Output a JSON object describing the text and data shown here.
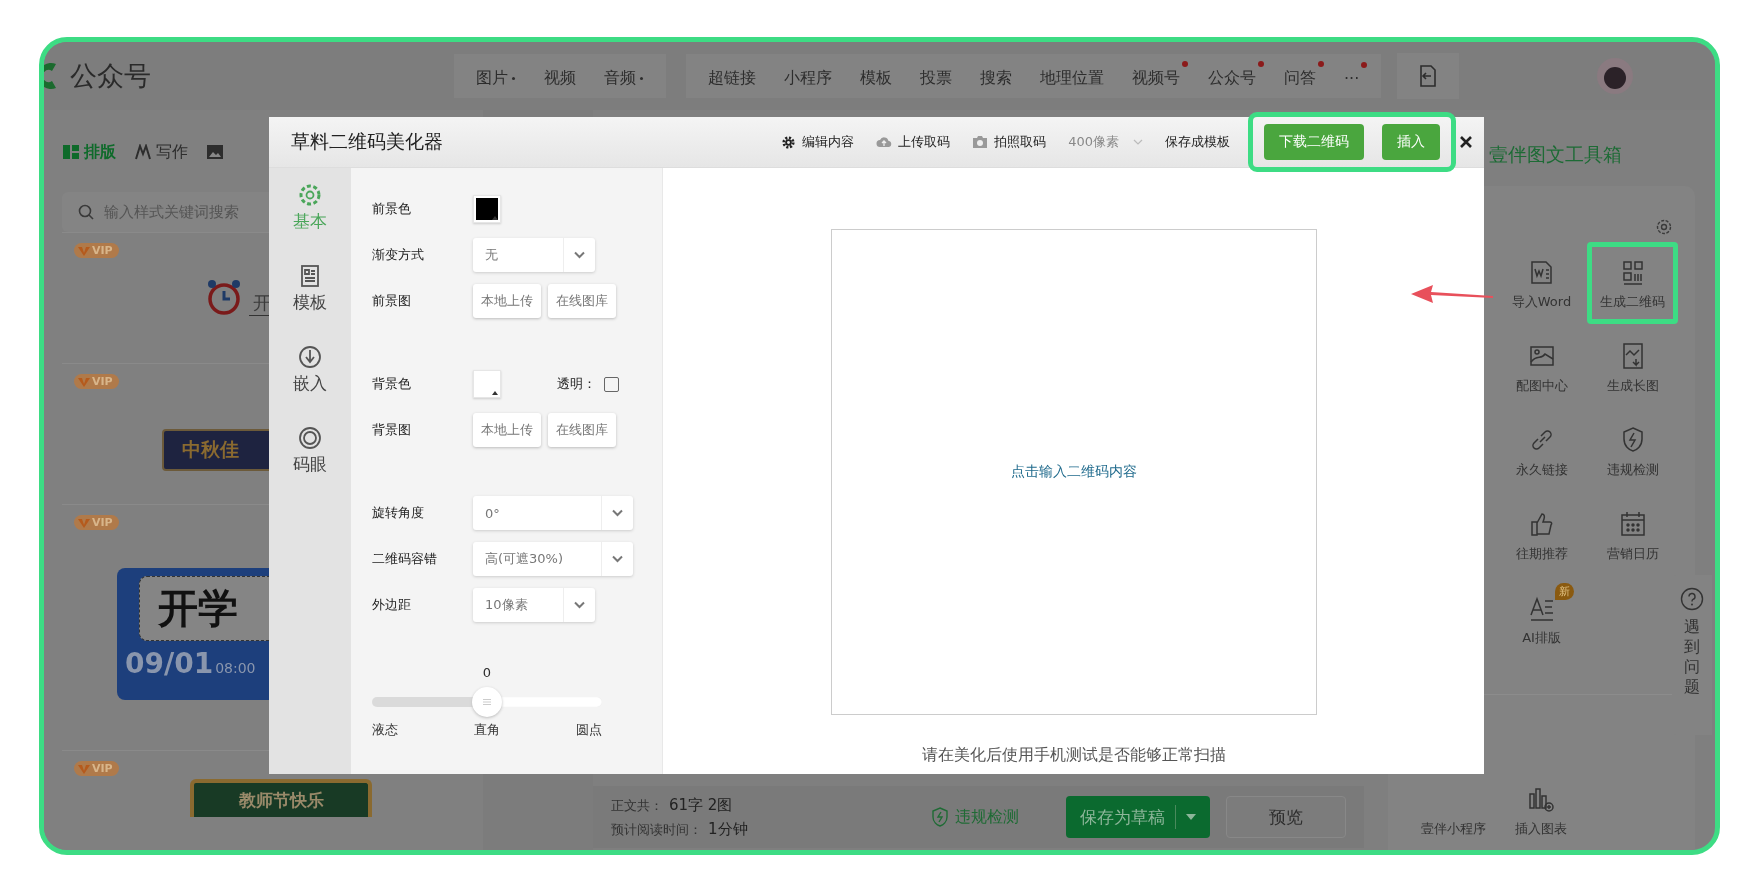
{
  "topbar": {
    "logo": "公众号",
    "nav_groups": [
      [
        {
          "label": "图片",
          "caret": true,
          "dot": false
        },
        {
          "label": "视频",
          "caret": false,
          "dot": false
        },
        {
          "label": "音频",
          "caret": true,
          "dot": false
        }
      ],
      [
        {
          "label": "超链接",
          "caret": false,
          "dot": false
        },
        {
          "label": "小程序",
          "caret": false,
          "dot": false
        },
        {
          "label": "模板",
          "caret": false,
          "dot": false
        },
        {
          "label": "投票",
          "caret": false,
          "dot": false
        },
        {
          "label": "搜索",
          "caret": false,
          "dot": false
        },
        {
          "label": "地理位置",
          "caret": false,
          "dot": false
        },
        {
          "label": "视频号",
          "caret": false,
          "dot": true
        },
        {
          "label": "公众号",
          "caret": false,
          "dot": true
        },
        {
          "label": "问答",
          "caret": false,
          "dot": true
        },
        {
          "label": "···",
          "caret": false,
          "dot": true
        }
      ]
    ]
  },
  "left_panel": {
    "tabs": [
      {
        "label": "排版",
        "selected": true
      },
      {
        "label": "写作",
        "selected": false
      }
    ],
    "search": {
      "placeholder": "输入样式关键词搜索"
    },
    "templates": [
      {
        "kind": "clock",
        "badge": "VIP",
        "text": "开"
      },
      {
        "kind": "banner",
        "badge": "VIP",
        "text": "中秋佳"
      },
      {
        "kind": "ticket",
        "badge": "VIP",
        "text": "开学",
        "date": "09/01",
        "time": "08:00"
      },
      {
        "kind": "plaque",
        "badge": "VIP",
        "text": "教师节快乐"
      }
    ]
  },
  "modal": {
    "title": "草料二维码美化器",
    "actions": [
      {
        "kind": "gear",
        "label": "编辑内容"
      },
      {
        "kind": "cloud",
        "label": "上传取码"
      },
      {
        "kind": "camera",
        "label": "拍照取码"
      },
      {
        "kind": "dropdown",
        "label": "400像素"
      },
      {
        "kind": "text",
        "label": "保存成模板"
      }
    ],
    "buttons": [
      "下载二维码",
      "插入"
    ],
    "buttons_highlighted": true,
    "nav": [
      {
        "kind": "gear",
        "label": "基本",
        "selected": true
      },
      {
        "kind": "doc",
        "label": "模板",
        "selected": false
      },
      {
        "kind": "download",
        "label": "嵌入",
        "selected": false
      },
      {
        "kind": "eye",
        "label": "码眼",
        "selected": false
      }
    ],
    "settings": [
      [
        {
          "kind": "color",
          "label": "前景色",
          "color": "#000000"
        },
        {
          "kind": "select",
          "label": "渐变方式",
          "value": "无"
        },
        {
          "kind": "buttons",
          "label": "前景图",
          "buttons": [
            "本地上传",
            "在线图库"
          ]
        }
      ],
      [
        {
          "kind": "color",
          "label": "背景色",
          "color": "#ffffff",
          "check_label": "透明：",
          "checked": false
        },
        {
          "kind": "buttons",
          "label": "背景图",
          "buttons": [
            "本地上传",
            "在线图库"
          ]
        }
      ],
      [
        {
          "kind": "select-wide",
          "label": "旋转角度",
          "value": "0°"
        },
        {
          "kind": "select-wide",
          "label": "二维码容错",
          "value": "高(可遮30%)"
        },
        {
          "kind": "select",
          "label": "外边距",
          "value": "10像素"
        }
      ]
    ],
    "slider": {
      "value": "0",
      "level": 0.5,
      "labels": [
        "液态",
        "直角",
        "圆点"
      ]
    },
    "preview": {
      "prompt": "点击输入二维码内容",
      "note": "请在美化后使用手机测试是否能够正常扫描"
    }
  },
  "toolbox": {
    "title": "壹伴图文工具箱",
    "tools": [
      {
        "kind": "word",
        "label": "导入Word",
        "highlighted": false
      },
      {
        "kind": "qrcode",
        "label": "生成二维码",
        "highlighted": true
      },
      {
        "kind": "image",
        "label": "配图中心",
        "highlighted": false
      },
      {
        "kind": "longimage",
        "label": "生成长图",
        "highlighted": false
      },
      {
        "kind": "link",
        "label": "永久链接",
        "highlighted": false
      },
      {
        "kind": "shield",
        "label": "违规检测",
        "highlighted": false
      },
      {
        "kind": "thumb",
        "label": "往期推荐",
        "highlighted": false
      },
      {
        "kind": "calendar",
        "label": "营销日历",
        "highlighted": false
      },
      {
        "kind": "ai",
        "label": "AI排版",
        "highlighted": false,
        "badge": "新"
      }
    ],
    "more_tools": [
      {
        "kind": "miniapp",
        "label": "壹伴小程序"
      },
      {
        "kind": "chart",
        "label": "插入图表"
      }
    ]
  },
  "help": {
    "label": "遇到问题"
  },
  "bottom_bar": {
    "count_label": "正文共：",
    "count": "61字 2图",
    "time_label": "预计阅读时间：",
    "time": "1分钟",
    "check": "违规检测",
    "save": "保存为草稿",
    "preview": "预览"
  }
}
